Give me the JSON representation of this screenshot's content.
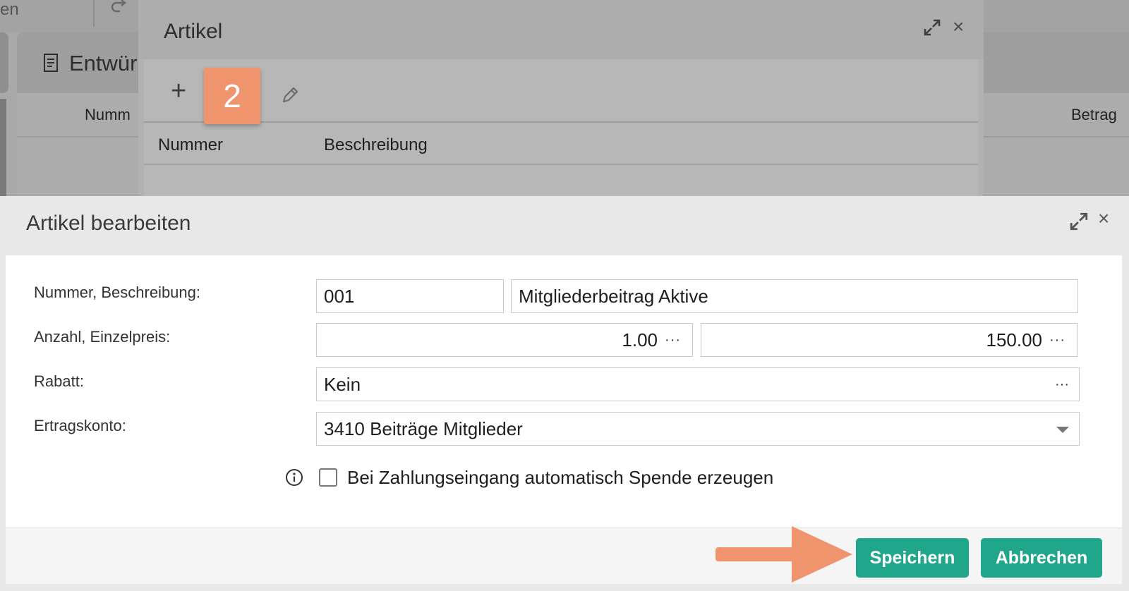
{
  "background": {
    "crumb_text": "en",
    "panel_title": "Entwür",
    "col_left": "Numm",
    "col_right": "Betrag"
  },
  "artikel_dialog": {
    "title": "Artikel",
    "step_badge": "2",
    "columns": [
      "Nummer",
      "Beschreibung"
    ]
  },
  "edit_dialog": {
    "title": "Artikel bearbeiten",
    "labels": {
      "nummer_beschreibung": "Nummer, Beschreibung:",
      "anzahl_einzelpreis": "Anzahl, Einzelpreis:",
      "rabatt": "Rabatt:",
      "ertragskonto": "Ertragskonto:"
    },
    "fields": {
      "nummer": "001",
      "beschreibung": "Mitgliederbeitrag Aktive",
      "anzahl": "1.00",
      "einzelpreis": "150.00",
      "rabatt": "Kein",
      "ertragskonto": "3410 Beiträge Mitglieder"
    },
    "ellipsis": "···",
    "checkbox_label": "Bei Zahlungseingang automatisch Spende erzeugen",
    "checkbox_checked": false,
    "buttons": {
      "save": "Speichern",
      "cancel": "Abbrechen"
    },
    "colors": {
      "button": "#20a68a",
      "callout": "#f0946e"
    }
  }
}
